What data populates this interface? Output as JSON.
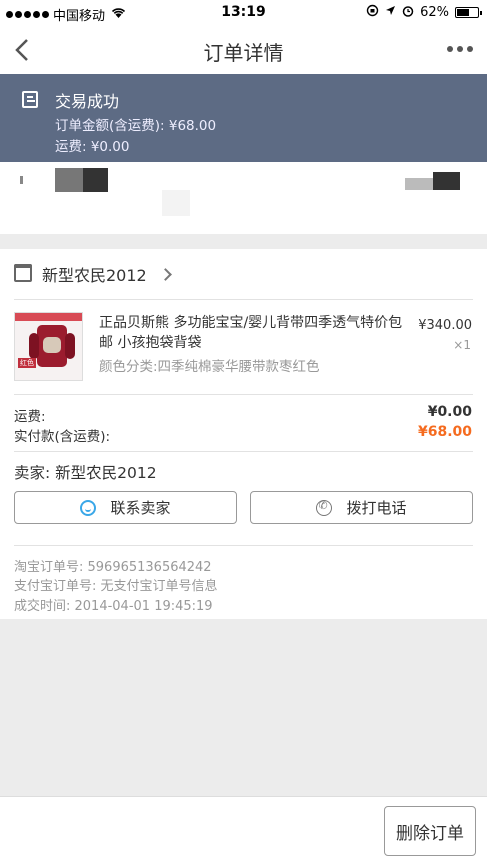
{
  "status_bar": {
    "carrier": "中国移动",
    "time": "13:19",
    "battery": "62%",
    "battery_level": 0.62
  },
  "nav": {
    "title": "订单详情"
  },
  "banner": {
    "status": "交易成功",
    "order_amount": "订单金额(含运费): ¥68.00",
    "shipping": "运费: ¥0.00"
  },
  "shop": {
    "name": "新型农民2012"
  },
  "item": {
    "title": "正品贝斯熊 多功能宝宝/婴儿背带四季透气特价包邮 小孩抱袋背袋",
    "sku": "颜色分类:四季纯棉豪华腰带款枣红色",
    "price": "¥340.00",
    "qty": "×1",
    "thumb_tag": "红色"
  },
  "totals": {
    "shipping_label": "运费:",
    "shipping_value": "¥0.00",
    "paid_label": "实付款(含运费):",
    "paid_value": "¥68.00"
  },
  "seller": {
    "label": "卖家: 新型农民2012",
    "contact_button": "联系卖家",
    "call_button": "拨打电话"
  },
  "order_meta": {
    "taobao_no": "淘宝订单号: 596965136564242",
    "alipay_no": "支付宝订单号: 无支付宝订单号信息",
    "deal_time": "成交时间: 2014-04-01 19:45:19"
  },
  "footer": {
    "delete_button": "删除订单"
  },
  "colors": {
    "banner": "#5d6b84",
    "price_accent": "#f56b1f",
    "chat_icon": "#3aa7e8"
  }
}
